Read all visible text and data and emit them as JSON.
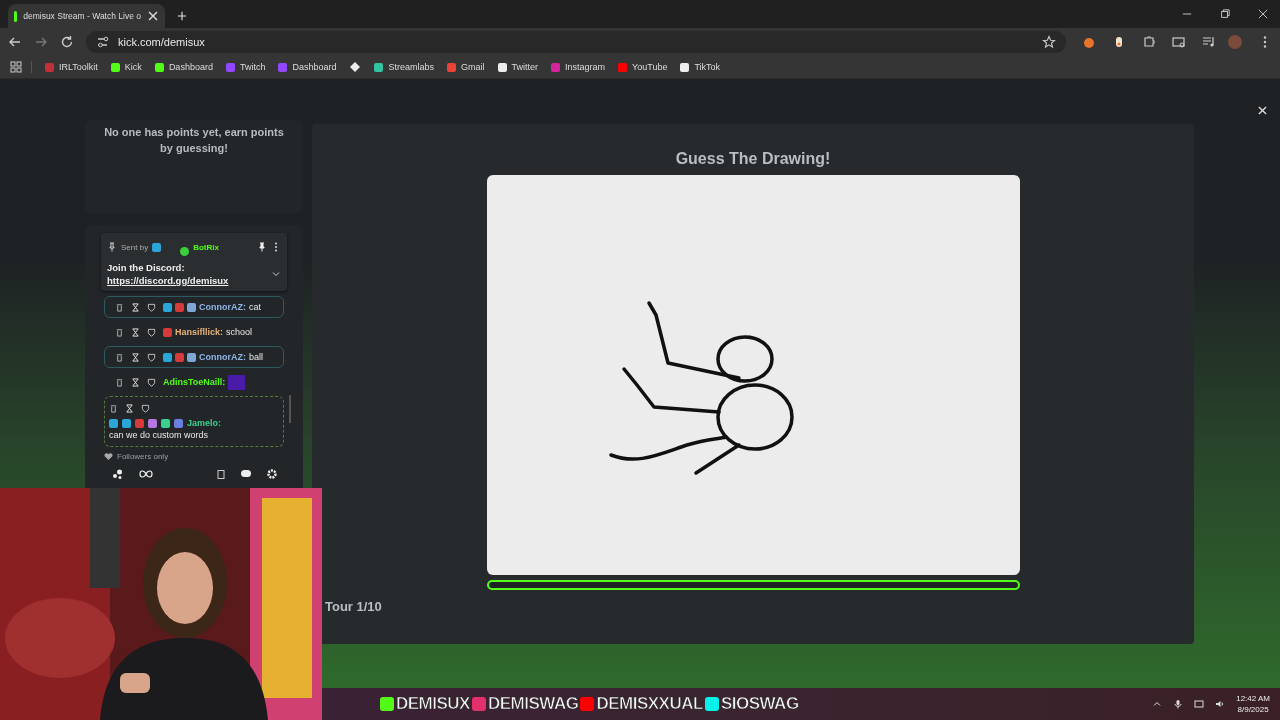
{
  "browser": {
    "tab": {
      "title": "demisux Stream - Watch Live o"
    },
    "url": "kick.com/demisux",
    "bookmarks": [
      {
        "kind": "link",
        "label": "IRLToolkit"
      },
      {
        "kind": "link",
        "label": "Kick"
      },
      {
        "kind": "link",
        "label": "Dashboard"
      },
      {
        "kind": "link",
        "label": "Twitch"
      },
      {
        "kind": "link",
        "label": "Dashboard"
      },
      {
        "kind": "icon"
      },
      {
        "kind": "link",
        "label": "Streamlabs"
      },
      {
        "kind": "link",
        "label": "Gmail"
      },
      {
        "kind": "link",
        "label": "Twitter"
      },
      {
        "kind": "link",
        "label": "Instagram"
      },
      {
        "kind": "link",
        "label": "YouTube"
      },
      {
        "kind": "link",
        "label": "TikTok"
      }
    ]
  },
  "leaderboard": {
    "empty_message": "No one has points yet, earn points by guessing!"
  },
  "chat": {
    "pinned": {
      "sent_by_label": "Sent by",
      "sender": "BotRix",
      "text": "Join the Discord:",
      "link": "https://discord.gg/demisux"
    },
    "messages": [
      {
        "kind": "boxed",
        "user": "ConnorAZ:",
        "color": "#8fb5e8",
        "text": "cat"
      },
      {
        "kind": "plain",
        "user": "Hansifllick:",
        "color": "#e8b27a",
        "text": "school"
      },
      {
        "kind": "boxed",
        "user": "ConnorAZ:",
        "color": "#8fb5e8",
        "text": "ball"
      },
      {
        "kind": "emote",
        "user": "AdinsToeNaill:",
        "color": "#53fc18"
      },
      {
        "kind": "dashed",
        "user": "Jamelo:",
        "color": "#3ad08e",
        "text": "can we do custom words"
      }
    ],
    "mode": "Followers only"
  },
  "game": {
    "title": "Guess The Drawing!",
    "timer": {
      "level": 0
    },
    "round": "Tour 1/10"
  },
  "stream_overlay": [
    "DEMISUX",
    "DEMISWAG",
    "DEMISXXUAL",
    "SIOSWAG"
  ],
  "taskbar": {
    "time": "12:42 AM",
    "date": "8/9/2025"
  }
}
